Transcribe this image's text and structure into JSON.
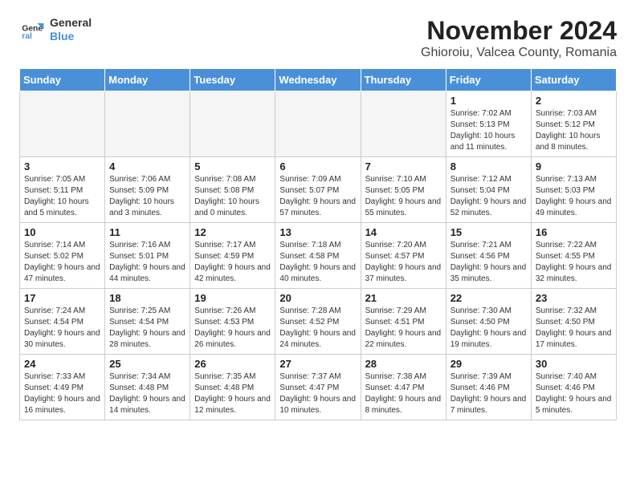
{
  "logo": {
    "line1": "General",
    "line2": "Blue"
  },
  "title": "November 2024",
  "subtitle": "Ghioroiu, Valcea County, Romania",
  "days_of_week": [
    "Sunday",
    "Monday",
    "Tuesday",
    "Wednesday",
    "Thursday",
    "Friday",
    "Saturday"
  ],
  "weeks": [
    [
      {
        "day": "",
        "info": ""
      },
      {
        "day": "",
        "info": ""
      },
      {
        "day": "",
        "info": ""
      },
      {
        "day": "",
        "info": ""
      },
      {
        "day": "",
        "info": ""
      },
      {
        "day": "1",
        "info": "Sunrise: 7:02 AM\nSunset: 5:13 PM\nDaylight: 10 hours and 11 minutes."
      },
      {
        "day": "2",
        "info": "Sunrise: 7:03 AM\nSunset: 5:12 PM\nDaylight: 10 hours and 8 minutes."
      }
    ],
    [
      {
        "day": "3",
        "info": "Sunrise: 7:05 AM\nSunset: 5:11 PM\nDaylight: 10 hours and 5 minutes."
      },
      {
        "day": "4",
        "info": "Sunrise: 7:06 AM\nSunset: 5:09 PM\nDaylight: 10 hours and 3 minutes."
      },
      {
        "day": "5",
        "info": "Sunrise: 7:08 AM\nSunset: 5:08 PM\nDaylight: 10 hours and 0 minutes."
      },
      {
        "day": "6",
        "info": "Sunrise: 7:09 AM\nSunset: 5:07 PM\nDaylight: 9 hours and 57 minutes."
      },
      {
        "day": "7",
        "info": "Sunrise: 7:10 AM\nSunset: 5:05 PM\nDaylight: 9 hours and 55 minutes."
      },
      {
        "day": "8",
        "info": "Sunrise: 7:12 AM\nSunset: 5:04 PM\nDaylight: 9 hours and 52 minutes."
      },
      {
        "day": "9",
        "info": "Sunrise: 7:13 AM\nSunset: 5:03 PM\nDaylight: 9 hours and 49 minutes."
      }
    ],
    [
      {
        "day": "10",
        "info": "Sunrise: 7:14 AM\nSunset: 5:02 PM\nDaylight: 9 hours and 47 minutes."
      },
      {
        "day": "11",
        "info": "Sunrise: 7:16 AM\nSunset: 5:01 PM\nDaylight: 9 hours and 44 minutes."
      },
      {
        "day": "12",
        "info": "Sunrise: 7:17 AM\nSunset: 4:59 PM\nDaylight: 9 hours and 42 minutes."
      },
      {
        "day": "13",
        "info": "Sunrise: 7:18 AM\nSunset: 4:58 PM\nDaylight: 9 hours and 40 minutes."
      },
      {
        "day": "14",
        "info": "Sunrise: 7:20 AM\nSunset: 4:57 PM\nDaylight: 9 hours and 37 minutes."
      },
      {
        "day": "15",
        "info": "Sunrise: 7:21 AM\nSunset: 4:56 PM\nDaylight: 9 hours and 35 minutes."
      },
      {
        "day": "16",
        "info": "Sunrise: 7:22 AM\nSunset: 4:55 PM\nDaylight: 9 hours and 32 minutes."
      }
    ],
    [
      {
        "day": "17",
        "info": "Sunrise: 7:24 AM\nSunset: 4:54 PM\nDaylight: 9 hours and 30 minutes."
      },
      {
        "day": "18",
        "info": "Sunrise: 7:25 AM\nSunset: 4:54 PM\nDaylight: 9 hours and 28 minutes."
      },
      {
        "day": "19",
        "info": "Sunrise: 7:26 AM\nSunset: 4:53 PM\nDaylight: 9 hours and 26 minutes."
      },
      {
        "day": "20",
        "info": "Sunrise: 7:28 AM\nSunset: 4:52 PM\nDaylight: 9 hours and 24 minutes."
      },
      {
        "day": "21",
        "info": "Sunrise: 7:29 AM\nSunset: 4:51 PM\nDaylight: 9 hours and 22 minutes."
      },
      {
        "day": "22",
        "info": "Sunrise: 7:30 AM\nSunset: 4:50 PM\nDaylight: 9 hours and 19 minutes."
      },
      {
        "day": "23",
        "info": "Sunrise: 7:32 AM\nSunset: 4:50 PM\nDaylight: 9 hours and 17 minutes."
      }
    ],
    [
      {
        "day": "24",
        "info": "Sunrise: 7:33 AM\nSunset: 4:49 PM\nDaylight: 9 hours and 16 minutes."
      },
      {
        "day": "25",
        "info": "Sunrise: 7:34 AM\nSunset: 4:48 PM\nDaylight: 9 hours and 14 minutes."
      },
      {
        "day": "26",
        "info": "Sunrise: 7:35 AM\nSunset: 4:48 PM\nDaylight: 9 hours and 12 minutes."
      },
      {
        "day": "27",
        "info": "Sunrise: 7:37 AM\nSunset: 4:47 PM\nDaylight: 9 hours and 10 minutes."
      },
      {
        "day": "28",
        "info": "Sunrise: 7:38 AM\nSunset: 4:47 PM\nDaylight: 9 hours and 8 minutes."
      },
      {
        "day": "29",
        "info": "Sunrise: 7:39 AM\nSunset: 4:46 PM\nDaylight: 9 hours and 7 minutes."
      },
      {
        "day": "30",
        "info": "Sunrise: 7:40 AM\nSunset: 4:46 PM\nDaylight: 9 hours and 5 minutes."
      }
    ]
  ]
}
